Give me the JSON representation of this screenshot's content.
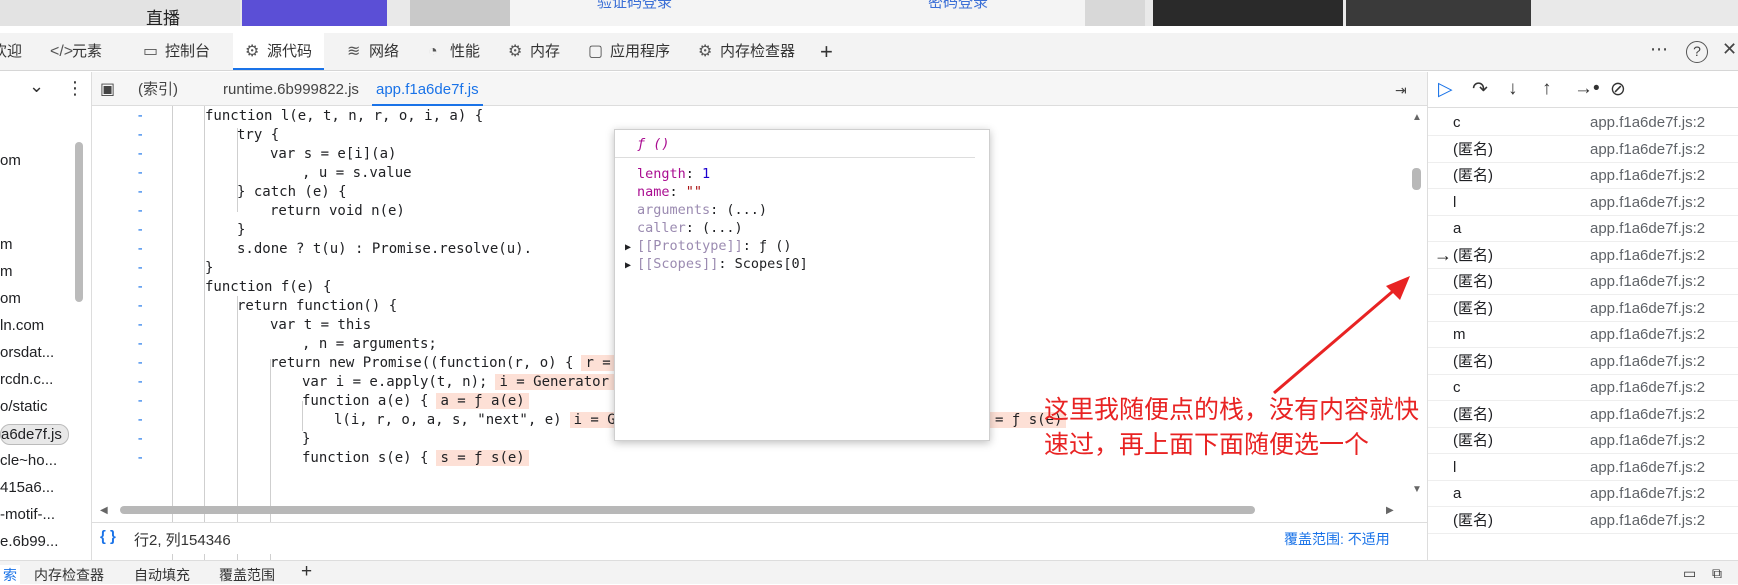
{
  "browser_strip": {
    "live_label": "直播",
    "link_left": "验证码登录",
    "link_right": "密码登录"
  },
  "devtools_tabs": [
    {
      "label": "欢迎",
      "icon": "welcome-icon"
    },
    {
      "label": "元素",
      "icon": "elements-icon"
    },
    {
      "label": "控制台",
      "icon": "console-icon"
    },
    {
      "label": "源代码",
      "icon": "sources-icon"
    },
    {
      "label": "网络",
      "icon": "network-icon"
    },
    {
      "label": "性能",
      "icon": "performance-icon"
    },
    {
      "label": "内存",
      "icon": "memory-icon"
    },
    {
      "label": "应用程序",
      "icon": "application-icon"
    },
    {
      "label": "内存检查器",
      "icon": "memory-inspector-icon"
    }
  ],
  "devtools_active_tab": "源代码",
  "icons": {
    "add": "+",
    "more": "⋯",
    "help": "?",
    "close": "✕",
    "chevron": "⌄",
    "kebab": "⋮"
  },
  "file_sidebar": {
    "items": [
      "om",
      "m",
      "m",
      "om",
      "ln.com",
      "orsdat...",
      "rcdn.c...",
      "o/static",
      "a6de7f.js",
      "cle~ho...",
      "415a6...",
      "-motif-...",
      "e.6b99..."
    ]
  },
  "editor_tabs": [
    {
      "label": "(索引)"
    },
    {
      "label": "runtime.6b999822.js"
    },
    {
      "label": "app.f1a6de7f.js"
    }
  ],
  "code_lines": [
    {
      "marker": "-",
      "text": "function l(e, t, n, r, o, i, a) {",
      "inline": ""
    },
    {
      "marker": "-",
      "text": "try {",
      "inline": ""
    },
    {
      "marker": "-",
      "text": "var s = e[i](a)",
      "inline": ""
    },
    {
      "marker": "-",
      "text": ", u = s.value",
      "inline": ""
    },
    {
      "marker": "-",
      "text": "} catch (e) {",
      "inline": ""
    },
    {
      "marker": "-",
      "text": "return void n(e)",
      "inline": ""
    },
    {
      "marker": "-",
      "text": "}",
      "inline": ""
    },
    {
      "marker": "-",
      "text": "s.done ? t(u) : Promise.resolve(u).",
      "inline": ""
    },
    {
      "marker": "-",
      "text": "}",
      "inline": ""
    },
    {
      "marker": "-",
      "text": "function f(e) {",
      "inline": ""
    },
    {
      "marker": "-",
      "text": "return function() {",
      "inline": ""
    },
    {
      "marker": "-",
      "text": "var t = this",
      "inline": ""
    },
    {
      "marker": "-",
      "text": ", n = arguments;",
      "inline": ""
    },
    {
      "marker": "-",
      "text": "return new Promise((function(r, o) {",
      "inline": "r = ƒ (), o = ƒ ()"
    },
    {
      "marker": "-",
      "text": "var i = e.apply(t, n);",
      "inline": "i = Generator {_invoke: ƒ}"
    },
    {
      "marker": "-",
      "text": "function a(e) {",
      "inline": "a = ƒ a(e)"
    },
    {
      "marker": "-",
      "text": "l(i, r, o, a, s, \"next\", e)",
      "inline": "i = Generator {_invoke: ƒ}, r = ƒ (), o = ƒ (), s = ƒ s(e)"
    },
    {
      "marker": "-",
      "text": "}",
      "inline": ""
    },
    {
      "marker": "-",
      "text": "function s(e) {",
      "inline": "s = ƒ s(e)"
    }
  ],
  "popup": {
    "title": "ƒ ()",
    "rows": [
      {
        "key": "length",
        "sep": ": ",
        "value": "1"
      },
      {
        "key": "name",
        "sep": ": ",
        "value": "\"\""
      },
      {
        "key": "arguments",
        "sep": ": ",
        "value": "(...)"
      },
      {
        "key": "caller",
        "sep": ": ",
        "value": "(...)"
      },
      {
        "key": "[[Prototype]]",
        "sep": ": ",
        "value": "ƒ ()"
      },
      {
        "key": "[[Scopes]]",
        "sep": ": ",
        "value": "Scopes[0]"
      }
    ]
  },
  "status": {
    "braces": "{ }",
    "position": "行2, 列154346",
    "coverage": "覆盖范围: 不适用"
  },
  "call_stack": [
    {
      "name": "c",
      "location": "app.f1a6de7f.js:2"
    },
    {
      "name": "(匿名)",
      "location": "app.f1a6de7f.js:2"
    },
    {
      "name": "(匿名)",
      "location": "app.f1a6de7f.js:2"
    },
    {
      "name": "l",
      "location": "app.f1a6de7f.js:2"
    },
    {
      "name": "a",
      "location": "app.f1a6de7f.js:2"
    },
    {
      "name": "(匿名)",
      "location": "app.f1a6de7f.js:2"
    },
    {
      "name": "(匿名)",
      "location": "app.f1a6de7f.js:2"
    },
    {
      "name": "(匿名)",
      "location": "app.f1a6de7f.js:2"
    },
    {
      "name": "m",
      "location": "app.f1a6de7f.js:2"
    },
    {
      "name": "(匿名)",
      "location": "app.f1a6de7f.js:2"
    },
    {
      "name": "c",
      "location": "app.f1a6de7f.js:2"
    },
    {
      "name": "(匿名)",
      "location": "app.f1a6de7f.js:2"
    },
    {
      "name": "(匿名)",
      "location": "app.f1a6de7f.js:2"
    },
    {
      "name": "l",
      "location": "app.f1a6de7f.js:2"
    },
    {
      "name": "a",
      "location": "app.f1a6de7f.js:2"
    },
    {
      "name": "(匿名)",
      "location": "app.f1a6de7f.js:2"
    }
  ],
  "call_stack_current": 5,
  "drawer_tabs": [
    "索",
    "内存检查器",
    "自动填充",
    "覆盖范围"
  ],
  "annotation": {
    "text": "这里我随便点的栈，没有内容就快速过，再上面下面随便选一个"
  }
}
